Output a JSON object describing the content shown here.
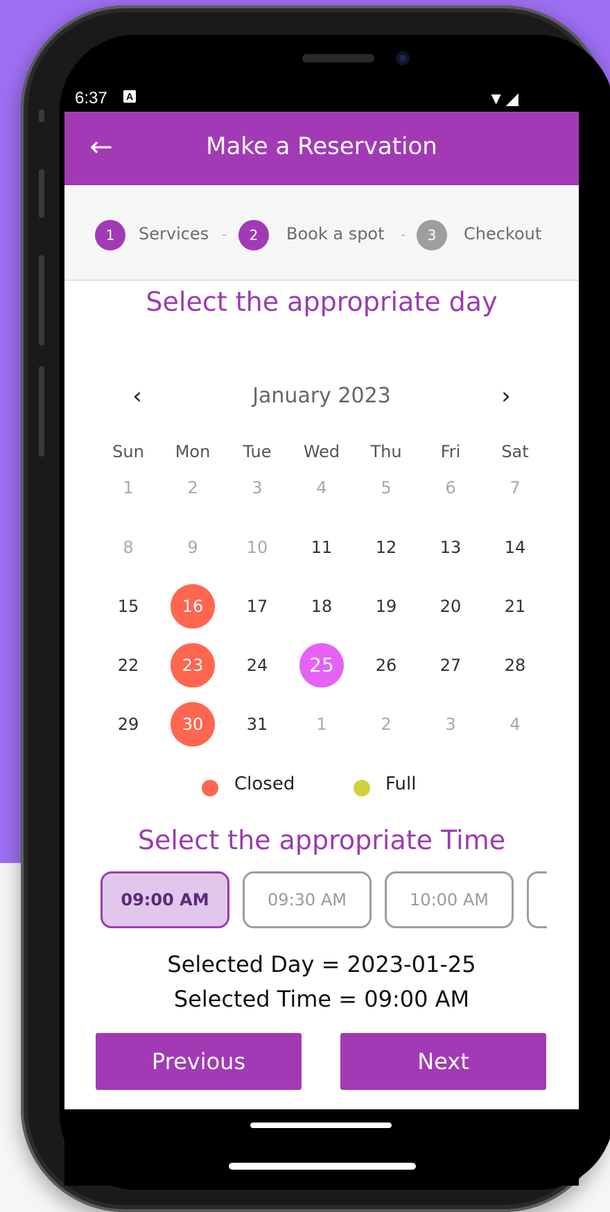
{
  "status_bar": {
    "time": "6:37",
    "notification_icon": "A",
    "icons": "▼◢"
  },
  "app_bar": {
    "title": "Make a Reservation",
    "back_icon": "←"
  },
  "stepper": {
    "steps": [
      {
        "number": "1",
        "label": "Services",
        "state": "done"
      },
      {
        "number": "2",
        "label": "Book a spot",
        "state": "active"
      },
      {
        "number": "3",
        "label": "Checkout",
        "state": "pending"
      }
    ],
    "colors": {
      "active": "#a23ab5",
      "pending": "#9e9e9e"
    }
  },
  "calendar": {
    "title": "Select the appropriate day",
    "month_label": "January 2023",
    "prev_icon": "‹",
    "next_icon": "›",
    "weekdays": [
      "Sun",
      "Mon",
      "Tue",
      "Wed",
      "Thu",
      "Fri",
      "Sat"
    ],
    "weeks": [
      [
        {
          "d": "1",
          "s": "muted"
        },
        {
          "d": "2",
          "s": "muted"
        },
        {
          "d": "3",
          "s": "muted"
        },
        {
          "d": "4",
          "s": "muted"
        },
        {
          "d": "5",
          "s": "muted"
        },
        {
          "d": "6",
          "s": "muted"
        },
        {
          "d": "7",
          "s": "muted"
        }
      ],
      [
        {
          "d": "8",
          "s": "muted"
        },
        {
          "d": "9",
          "s": "muted"
        },
        {
          "d": "10",
          "s": "muted"
        },
        {
          "d": "11",
          "s": "active"
        },
        {
          "d": "12",
          "s": "active"
        },
        {
          "d": "13",
          "s": "active"
        },
        {
          "d": "14",
          "s": "active"
        }
      ],
      [
        {
          "d": "15",
          "s": "active"
        },
        {
          "d": "16",
          "s": "closed"
        },
        {
          "d": "17",
          "s": "active"
        },
        {
          "d": "18",
          "s": "active"
        },
        {
          "d": "19",
          "s": "active"
        },
        {
          "d": "20",
          "s": "active"
        },
        {
          "d": "21",
          "s": "active"
        }
      ],
      [
        {
          "d": "22",
          "s": "active"
        },
        {
          "d": "23",
          "s": "closed"
        },
        {
          "d": "24",
          "s": "active"
        },
        {
          "d": "25",
          "s": "selected"
        },
        {
          "d": "26",
          "s": "active"
        },
        {
          "d": "27",
          "s": "active"
        },
        {
          "d": "28",
          "s": "active"
        }
      ],
      [
        {
          "d": "29",
          "s": "active"
        },
        {
          "d": "30",
          "s": "closed"
        },
        {
          "d": "31",
          "s": "active"
        },
        {
          "d": "1",
          "s": "muted"
        },
        {
          "d": "2",
          "s": "muted"
        },
        {
          "d": "3",
          "s": "muted"
        },
        {
          "d": "4",
          "s": "muted"
        }
      ]
    ],
    "colors": {
      "closed": "#ff6650",
      "selected": "#e662f6",
      "full": "#cfd23a"
    }
  },
  "legend": {
    "closed_label": "Closed",
    "full_label": "Full"
  },
  "time_picker": {
    "title": "Select the appropriate Time",
    "slots": [
      {
        "label": "09:00 AM",
        "selected": true
      },
      {
        "label": "09:30 AM",
        "selected": false
      },
      {
        "label": "10:00 AM",
        "selected": false
      },
      {
        "label": "",
        "selected": false
      }
    ]
  },
  "summary": {
    "selected_day": "Selected Day = 2023-01-25",
    "selected_time": "Selected Time = 09:00 AM"
  },
  "buttons": {
    "previous": "Previous",
    "next": "Next"
  },
  "accent_color": "#a23ab5"
}
